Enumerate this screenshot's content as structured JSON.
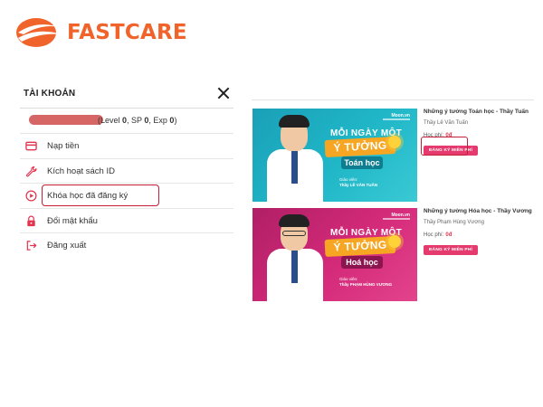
{
  "brand": {
    "name": "FASTCARE",
    "color": "#f0642b"
  },
  "account": {
    "title": "TÀI KHOẢN",
    "user": {
      "level_prefix": "(Level ",
      "level": "0",
      "sp_prefix": ", SP ",
      "sp": "0",
      "exp_prefix": ", Exp ",
      "exp": "0",
      "suffix": ")"
    },
    "menu": [
      {
        "label": "Nạp tiền",
        "icon": "card-icon"
      },
      {
        "label": "Kích hoạt sách ID",
        "icon": "wrench-icon"
      },
      {
        "label": "Khóa học đã đăng ký",
        "icon": "play-circle-icon",
        "highlighted": true
      },
      {
        "label": "Đổi mật khẩu",
        "icon": "lock-icon"
      },
      {
        "label": "Đăng xuất",
        "icon": "logout-icon"
      }
    ]
  },
  "courses": [
    {
      "title": "Những ý tưởng Toán học - Thầy Tuấn",
      "teacher": "Thầy Lê Văn Tuấn",
      "fee_label": "Học phí:",
      "fee": "0đ",
      "button": "ĐĂNG KÝ MIỄN PHÍ",
      "thumb": {
        "brand": "Moon.vn",
        "line1": "MỖI NGÀY MỘT",
        "highlight": "Ý TƯỞNG",
        "subject": "Toán học",
        "teacher_label": "Giáo viên:",
        "teacher_name": "Thầy LÊ VĂN TUẤN"
      }
    },
    {
      "title": "Những ý tưởng Hóa học - Thầy Vương",
      "teacher": "Thầy Phạm Hùng Vương",
      "fee_label": "Học phí:",
      "fee": "0đ",
      "button": "ĐĂNG KÝ MIỄN PHÍ",
      "thumb": {
        "brand": "Moon.vn",
        "line1": "MỖI NGÀY MỘT",
        "highlight": "Ý TƯỞNG",
        "subject": "Hoá học",
        "teacher_label": "Giáo viên:",
        "teacher_name": "Thầy PHẠM HÙNG VƯƠNG"
      }
    }
  ],
  "colors": {
    "highlight_border": "#c41e3a",
    "button": "#e53a6e",
    "price": "#e6324b",
    "thumb_math": "#20b7c8",
    "thumb_chem": "#d42a7a"
  }
}
